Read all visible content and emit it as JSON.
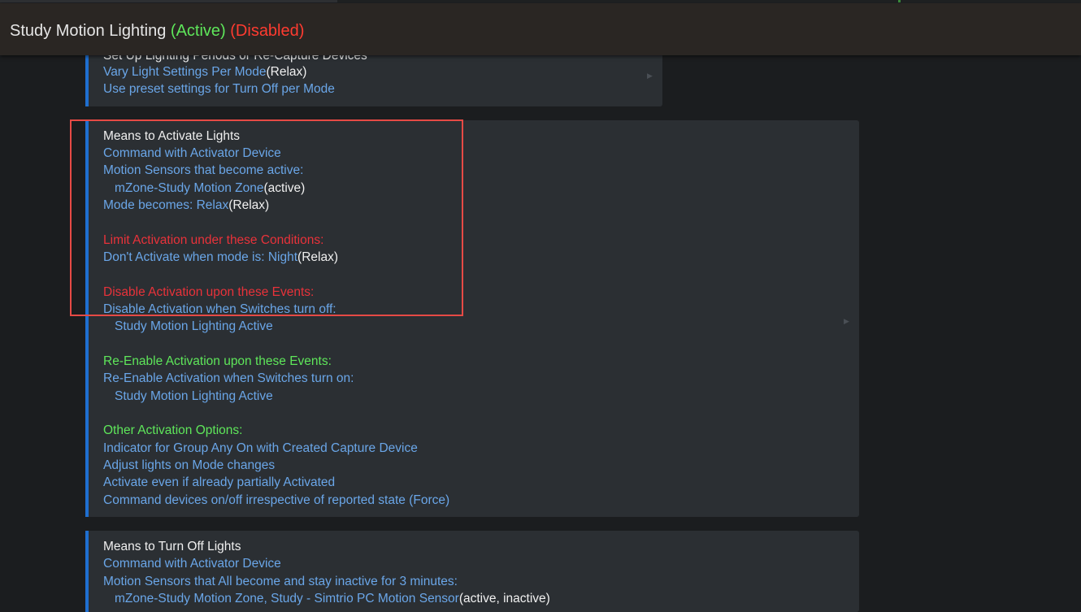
{
  "header": {
    "title": "Study Motion Lighting",
    "status_active": "(Active)",
    "status_disabled": "(Disabled)"
  },
  "colors": {
    "header_bg": "#2a2623",
    "page_bg": "#1b1d1f",
    "card_bg": "#2b2f33",
    "accent_blue": "#1f6fd0",
    "link_blue": "#6aa6e8",
    "warn_red": "#e8323a",
    "ok_green": "#5ee65a",
    "highlight_red": "#e64a45"
  },
  "periods_section": {
    "title": "Set Up Lighting Periods or Re-Capture Devices",
    "vary_label": "Vary Light Settings Per Mode",
    "vary_value": "(Relax)",
    "preset_label": "Use preset settings for Turn Off per Mode"
  },
  "activate_section": {
    "title": "Means to Activate Lights",
    "command_label": "Command with Activator Device",
    "motion_label": "Motion Sensors that become active:",
    "motion_device": "mZone-Study Motion Zone",
    "motion_state": "(active)",
    "mode_label": "Mode becomes: Relax",
    "mode_value": "(Relax)",
    "limit_title": "Limit Activation under these Conditions:",
    "dont_activate_label": "Don't Activate when mode is: Night",
    "dont_activate_value": "(Relax)",
    "disable_title": "Disable Activation upon these Events:",
    "disable_label": "Disable Activation when Switches turn off:",
    "disable_device": "Study Motion Lighting Active",
    "reenable_title": "Re-Enable Activation upon these Events:",
    "reenable_label": "Re-Enable Activation when Switches turn on:",
    "reenable_device": "Study Motion Lighting Active",
    "other_title": "Other Activation Options:",
    "options": [
      "Indicator for Group Any On with Created Capture Device",
      "Adjust lights on Mode changes",
      "Activate even if already partially Activated",
      "Command devices on/off irrespective of reported state (Force)"
    ]
  },
  "turnoff_section": {
    "title": "Means to Turn Off Lights",
    "command_label": "Command with Activator Device",
    "motion_label": "Motion Sensors that All become and stay inactive for 3 minutes:",
    "motion_devices": "mZone-Study Motion Zone, Study - Simtrio PC Motion Sensor",
    "motion_states": "(active, inactive)"
  },
  "icons": {
    "expand": "chevron-right-icon"
  }
}
